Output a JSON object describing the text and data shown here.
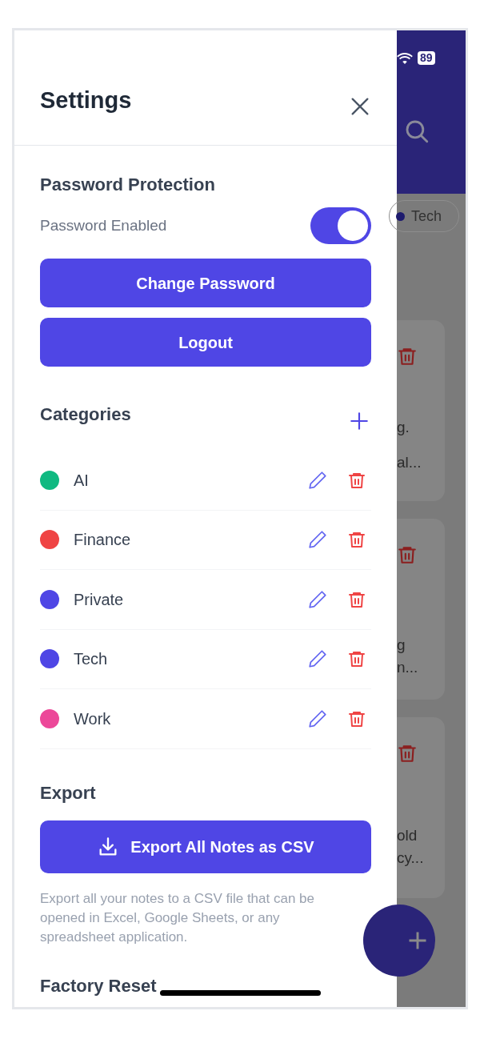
{
  "status_bar": {
    "battery": "89"
  },
  "settings": {
    "title": "Settings",
    "password": {
      "heading": "Password Protection",
      "toggle_label": "Password Enabled",
      "on": true,
      "buttons": [
        "Change Password",
        "Logout"
      ]
    },
    "categories": {
      "heading": "Categories",
      "items": [
        {
          "name": "AI",
          "color": "#10b981"
        },
        {
          "name": "Finance",
          "color": "#ef4444"
        },
        {
          "name": "Private",
          "color": "#4f46e5"
        },
        {
          "name": "Tech",
          "color": "#4f46e5"
        },
        {
          "name": "Work",
          "color": "#ec4899"
        }
      ]
    },
    "export": {
      "heading": "Export",
      "button": "Export All Notes as CSV",
      "description": "Export all your notes to a CSV file that can be opened in Excel, Google Sheets, or any spreadsheet application."
    },
    "factory_reset": {
      "heading": "Factory Reset"
    }
  },
  "background": {
    "chip": {
      "label": "Tech",
      "color": "#1e1b6e"
    },
    "cards": [
      {
        "lines": [
          "g.",
          "al..."
        ]
      },
      {
        "lines": [
          "g",
          "n..."
        ]
      },
      {
        "lines": [
          "old",
          "cy..."
        ]
      }
    ]
  }
}
